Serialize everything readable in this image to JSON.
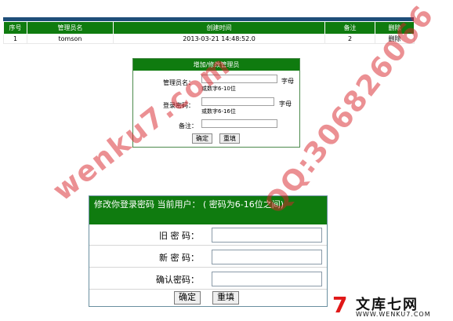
{
  "admin_table": {
    "headers": [
      "序号",
      "管理员名",
      "创建时间",
      "备注",
      "删除"
    ],
    "rows": [
      {
        "id": "1",
        "name": "tomson",
        "created": "2013-03-21 14:48:52.0",
        "remark": "2",
        "delete": "删除"
      }
    ]
  },
  "add_form": {
    "title": "增加/修改管理员",
    "name_label": "管理员名：",
    "name_unit": "字母",
    "name_hint": "或数字6-10位",
    "password_label": "登录密码：",
    "password_unit": "字母",
    "password_hint": "或数字6-16位",
    "remark_label": "备注：",
    "submit": "确定",
    "reset": "重填"
  },
  "password_form": {
    "title": "修改你登录密码 当前用户： ( 密码为6-16位之间)",
    "old_label": "旧 密 码：",
    "new_label": "新 密 码：",
    "confirm_label": "确认密码：",
    "submit": "确定",
    "reset": "重填"
  },
  "watermarks": {
    "site": "wenku7.com",
    "qq": "QQ:306826066"
  },
  "logo": {
    "mark": "7",
    "name": "文库七网",
    "url": "WWW.WENKU7.COM"
  },
  "colors": {
    "header_green": "#0f7b0f",
    "watermark_red": "#d9232a"
  }
}
